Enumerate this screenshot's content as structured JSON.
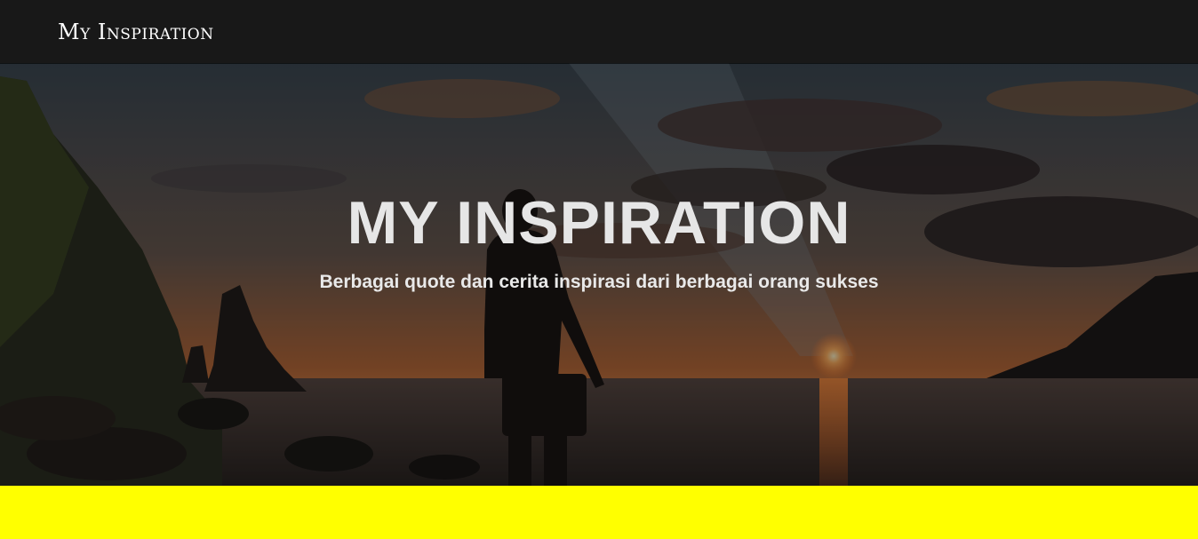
{
  "navbar": {
    "brand": "My Inspiration"
  },
  "hero": {
    "title": "MY INSPIRATION",
    "subtitle": "Berbagai quote dan cerita inspirasi dari berbagai orang sukses",
    "background": "sunset-beach-silhouette-photo"
  },
  "colors": {
    "navbar_bg": "#181818",
    "band_bg": "#ffff00",
    "hero_text": "#e6e6e6"
  }
}
